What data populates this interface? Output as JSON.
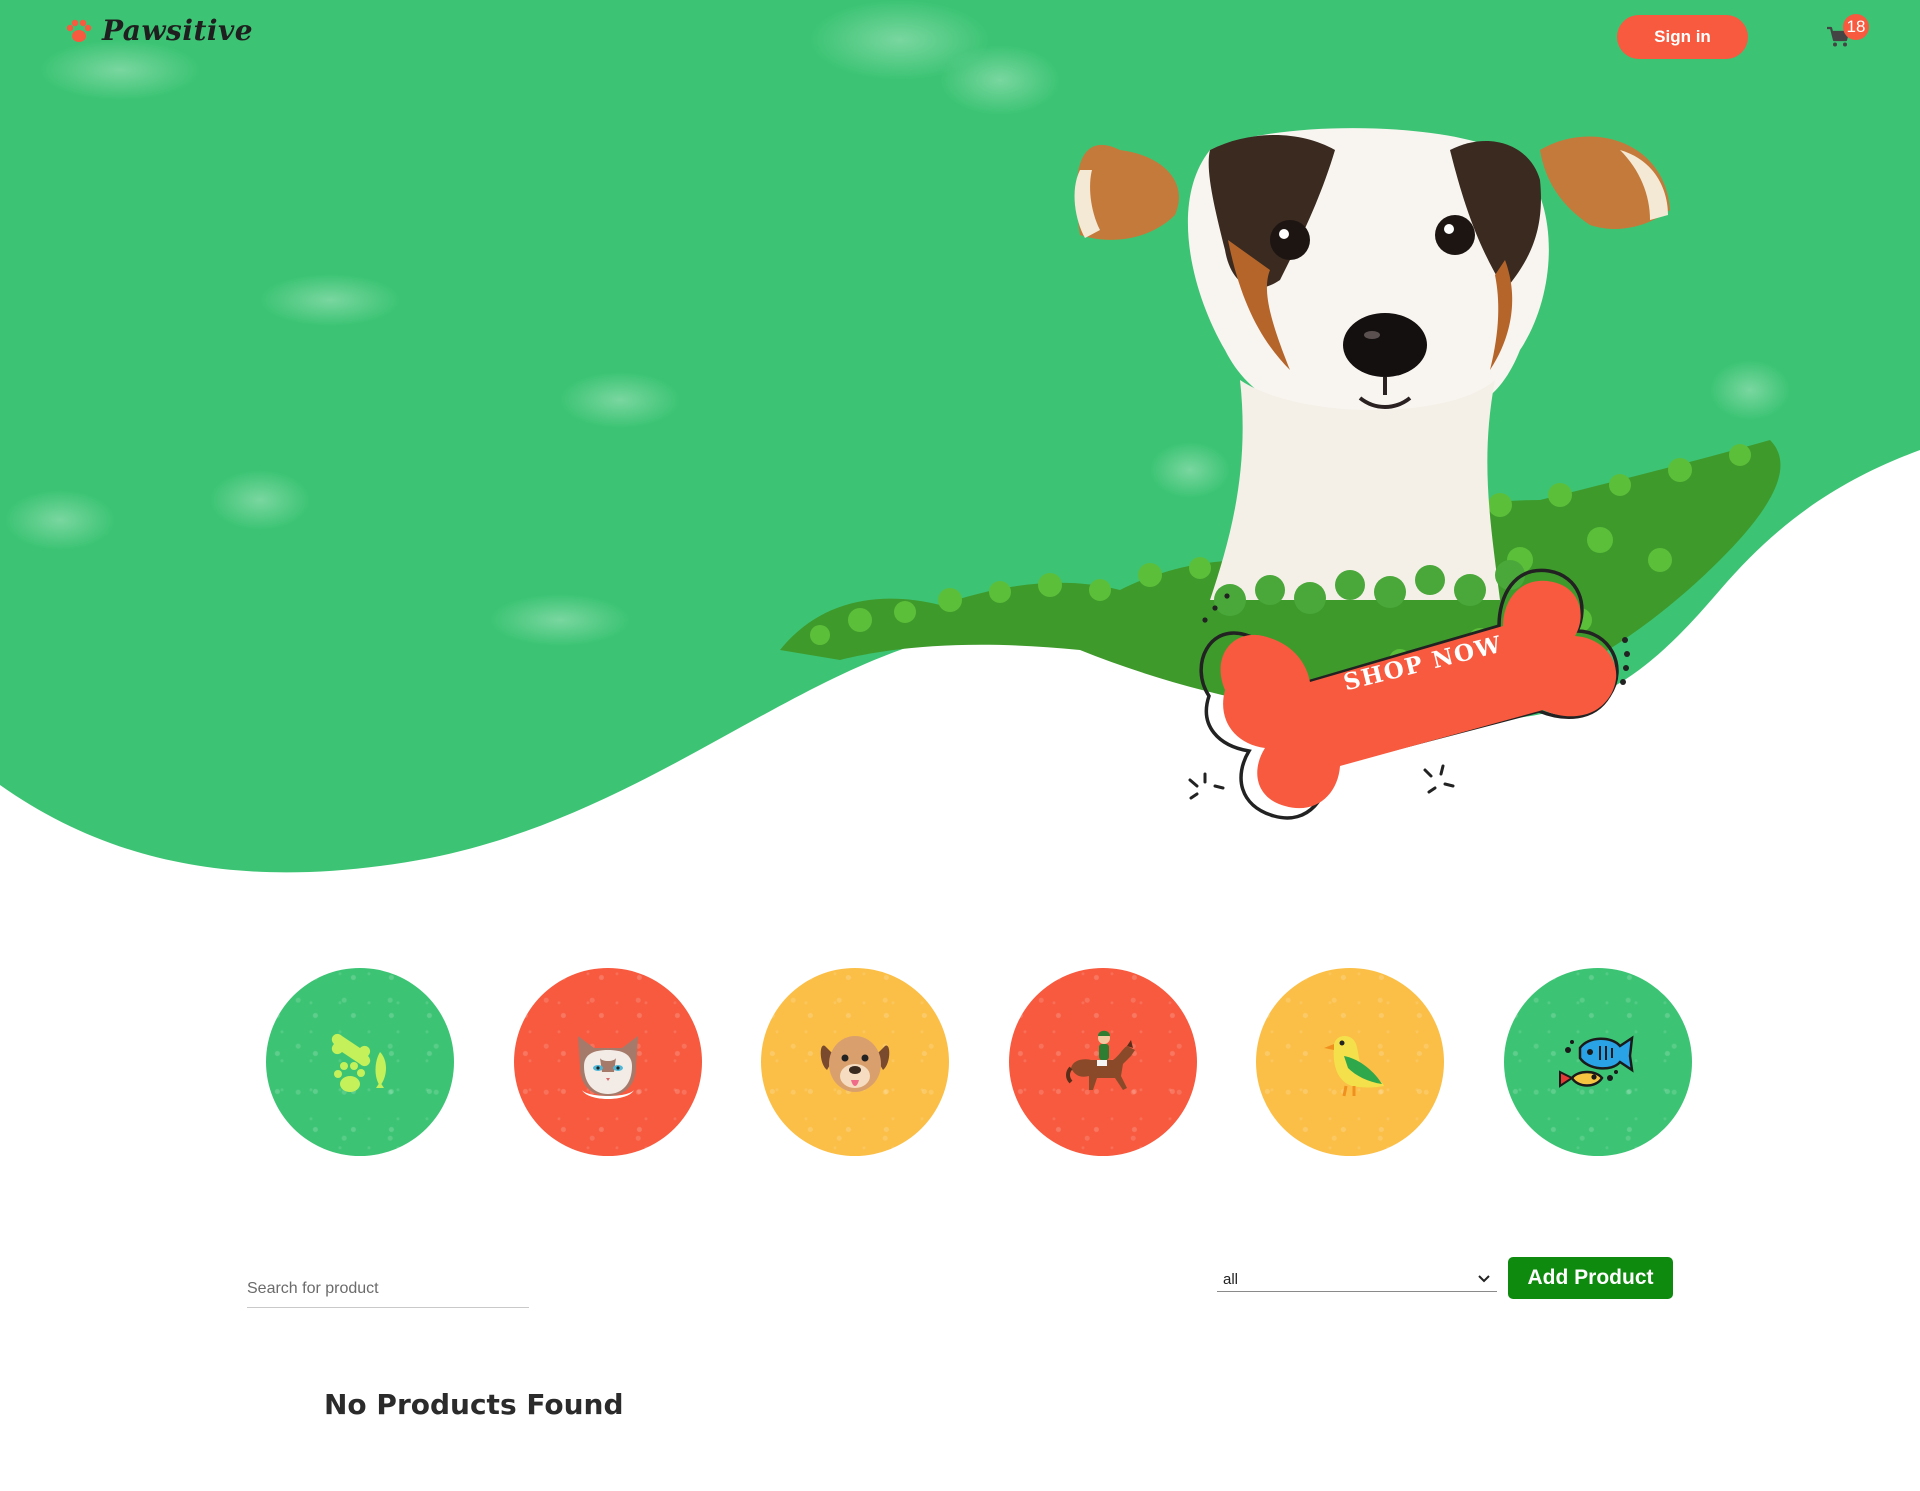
{
  "brand": {
    "name": "Pawsitive",
    "logo_icon": "paw-icon"
  },
  "header": {
    "signin_label": "Sign in",
    "cart": {
      "icon": "cart-icon",
      "count": "18"
    }
  },
  "hero": {
    "cta_label": "SHOP NOW",
    "image": "dog-peeking-over-grass"
  },
  "categories": [
    {
      "name": "accessories",
      "icon": "bone-paw-fish-icon",
      "color": "#3cc474"
    },
    {
      "name": "cats",
      "icon": "cat-icon",
      "color": "#f75a3f"
    },
    {
      "name": "dogs",
      "icon": "dog-icon",
      "color": "#fbbf47"
    },
    {
      "name": "horses",
      "icon": "horse-rider-icon",
      "color": "#f75a3f"
    },
    {
      "name": "birds",
      "icon": "bird-icon",
      "color": "#fbbf47"
    },
    {
      "name": "fish",
      "icon": "fish-icon",
      "color": "#3cc474"
    }
  ],
  "toolbar": {
    "search_placeholder": "Search for product",
    "filter_value": "all",
    "add_product_label": "Add Product"
  },
  "results": {
    "empty_message": "No Products Found"
  },
  "colors": {
    "green": "#3cc474",
    "coral": "#f75a3f",
    "yellow": "#fbbf47",
    "button_green": "#0e8a0e"
  }
}
